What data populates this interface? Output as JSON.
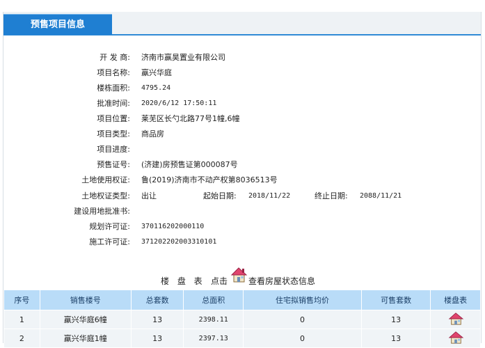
{
  "tab": {
    "label": "预售项目信息"
  },
  "info": {
    "developer": {
      "label": "开 发 商:",
      "value": "济南市赢昊置业有限公司"
    },
    "project_name": {
      "label": "项目名称:",
      "value": "羸兴华庭"
    },
    "building_area": {
      "label": "楼栋面积:",
      "value": "4795.24"
    },
    "approval_time": {
      "label": "批准时间:",
      "value": "2020/6/12 17:50:11"
    },
    "location": {
      "label": "项目位置:",
      "value": "莱芜区长勺北路77号1幢,6幢"
    },
    "project_type": {
      "label": "项目类型:",
      "value": "商品房"
    },
    "progress": {
      "label": "项目进度:",
      "value": ""
    },
    "presale_cert": {
      "label": "预售证号:",
      "value": "(济建)房预售证第000087号"
    },
    "land_use_cert": {
      "label": "土地使用权证:",
      "value": "鲁(2019)济南市不动产权第8036513号"
    },
    "land_type": {
      "label": "土地权证类型:",
      "value": "出让",
      "start_label": "起始日期:",
      "start_value": "2018/11/22",
      "end_label": "终止日期:",
      "end_value": "2088/11/21"
    },
    "land_approval": {
      "label": "建设用地批准书:",
      "value": ""
    },
    "planning_permit": {
      "label": "规划许可证:",
      "value": "370116202000110"
    },
    "construction_permit": {
      "label": "施工许可证:",
      "value": "371202202003310101"
    }
  },
  "building_header": {
    "title": "楼 盘 表",
    "click": "点击",
    "hint": "查看房屋状态信息",
    "icon": "house-icon"
  },
  "table": {
    "headers": [
      "序号",
      "销售楼号",
      "总套数",
      "总面积",
      "住宅拟销售均价",
      "可售套数",
      "楼盘表"
    ],
    "rows": [
      {
        "no": "1",
        "building": "羸兴华庭6幢",
        "units": "13",
        "area": "2398.11",
        "price": "0",
        "available": "13"
      },
      {
        "no": "2",
        "building": "羸兴华庭1幢",
        "units": "13",
        "area": "2397.13",
        "price": "0",
        "available": "13"
      }
    ]
  },
  "colors": {
    "tab_blue": "#1f7fd2",
    "header_blue": "#b9dcf8",
    "house_roof": "#e0456e"
  }
}
